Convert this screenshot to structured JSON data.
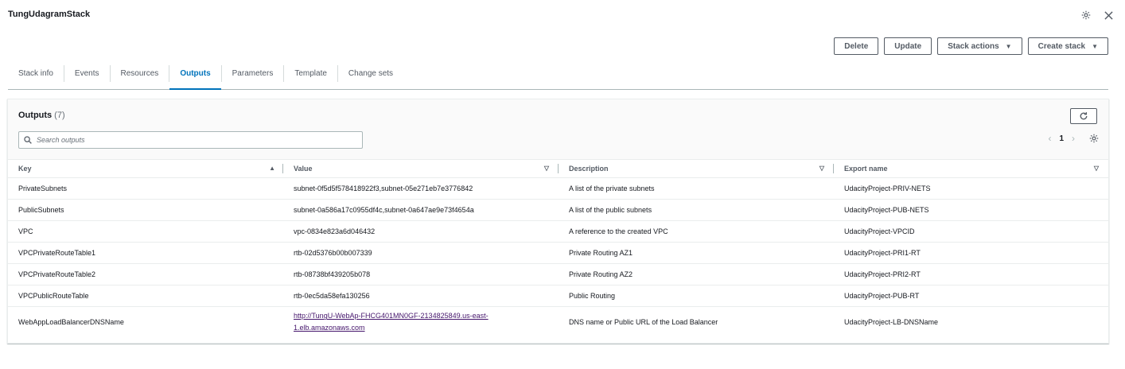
{
  "header": {
    "title": "TungUdagramStack",
    "settings_icon": "gear-icon",
    "close_icon": "close-icon"
  },
  "actions": {
    "delete": "Delete",
    "update": "Update",
    "stack_actions": "Stack actions",
    "create_stack": "Create stack"
  },
  "tabs": [
    {
      "label": "Stack info"
    },
    {
      "label": "Events"
    },
    {
      "label": "Resources"
    },
    {
      "label": "Outputs",
      "active": true
    },
    {
      "label": "Parameters"
    },
    {
      "label": "Template"
    },
    {
      "label": "Change sets"
    }
  ],
  "outputs": {
    "title": "Outputs",
    "count": "(7)",
    "search_placeholder": "Search outputs",
    "page": "1",
    "columns": [
      "Key",
      "Value",
      "Description",
      "Export name"
    ],
    "rows": [
      {
        "key": "PrivateSubnets",
        "value": "subnet-0f5d5f578418922f3,subnet-05e271eb7e3776842",
        "description": "A list of the private subnets",
        "export": "UdacityProject-PRIV-NETS"
      },
      {
        "key": "PublicSubnets",
        "value": "subnet-0a586a17c0955df4c,subnet-0a647ae9e73f4654a",
        "description": "A list of the public subnets",
        "export": "UdacityProject-PUB-NETS"
      },
      {
        "key": "VPC",
        "value": "vpc-0834e823a6d046432",
        "description": "A reference to the created VPC",
        "export": "UdacityProject-VPCID"
      },
      {
        "key": "VPCPrivateRouteTable1",
        "value": "rtb-02d5376b00b007339",
        "description": "Private Routing AZ1",
        "export": "UdacityProject-PRI1-RT"
      },
      {
        "key": "VPCPrivateRouteTable2",
        "value": "rtb-08738bf439205b078",
        "description": "Private Routing AZ2",
        "export": "UdacityProject-PRI2-RT"
      },
      {
        "key": "VPCPublicRouteTable",
        "value": "rtb-0ec5da58efa130256",
        "description": "Public Routing",
        "export": "UdacityProject-PUB-RT"
      }
    ],
    "last_row": {
      "key": "WebAppLoadBalancerDNSName",
      "value_line1": "http://TungU-WebAp-FHCG401MN0GF-2134825849.us-east-",
      "value_line2": "1.elb.amazonaws.com",
      "description": "DNS name or Public URL of the Load Balancer",
      "export": "UdacityProject-LB-DNSName"
    }
  }
}
